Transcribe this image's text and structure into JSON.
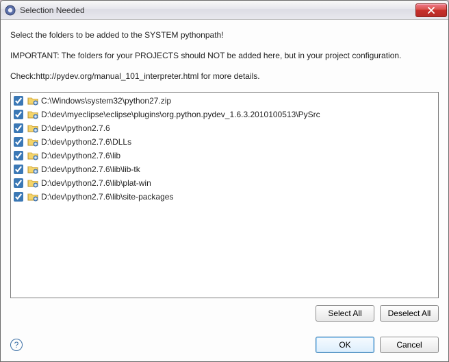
{
  "window": {
    "title": "Selection Needed"
  },
  "desc": {
    "line1": "Select the folders to be added to the SYSTEM pythonpath!",
    "line2": "IMPORTANT: The folders for your PROJECTS should NOT be added here, but in your project configuration.",
    "line3": "Check:http://pydev.org/manual_101_interpreter.html for more details."
  },
  "items": [
    {
      "checked": true,
      "path": "C:\\Windows\\system32\\python27.zip"
    },
    {
      "checked": true,
      "path": "D:\\dev\\myeclipse\\eclipse\\plugins\\org.python.pydev_1.6.3.2010100513\\PySrc"
    },
    {
      "checked": true,
      "path": "D:\\dev\\python2.7.6"
    },
    {
      "checked": true,
      "path": "D:\\dev\\python2.7.6\\DLLs"
    },
    {
      "checked": true,
      "path": "D:\\dev\\python2.7.6\\lib"
    },
    {
      "checked": true,
      "path": "D:\\dev\\python2.7.6\\lib\\lib-tk"
    },
    {
      "checked": true,
      "path": "D:\\dev\\python2.7.6\\lib\\plat-win"
    },
    {
      "checked": true,
      "path": "D:\\dev\\python2.7.6\\lib\\site-packages"
    }
  ],
  "buttons": {
    "select_all": "Select All",
    "deselect_all": "Deselect All",
    "ok": "OK",
    "cancel": "Cancel",
    "help": "?"
  }
}
